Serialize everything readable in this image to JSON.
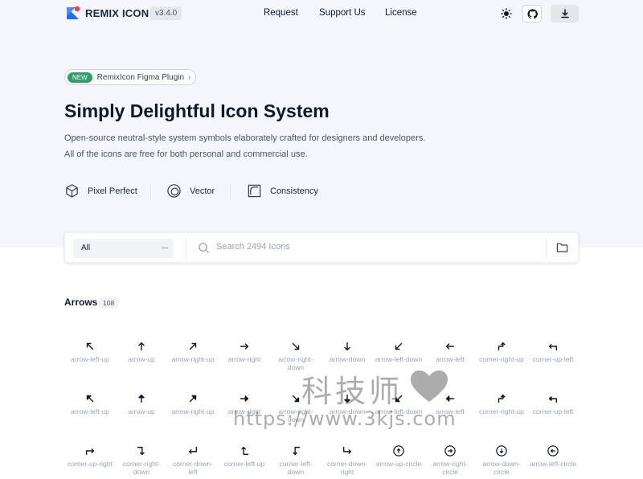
{
  "header": {
    "brand": "REMIX ICON",
    "version": "v3.4.0",
    "nav": [
      "Request",
      "Support Us",
      "License"
    ],
    "icons": [
      "sun-icon",
      "github-icon",
      "download-icon"
    ]
  },
  "hero": {
    "badge": "NEW",
    "pill_text": "RemixIcon Figma Plugin",
    "pill_chevron": "›",
    "title": "Simply Delightful Icon System",
    "desc_line1": "Open-source neutral-style system symbols elaborately crafted for designers and developers.",
    "desc_line2": "All of the icons are free for both personal and commercial use.",
    "features": [
      {
        "label": "Pixel Perfect",
        "icon": "cube-icon"
      },
      {
        "label": "Vector",
        "icon": "vector-circle-icon"
      },
      {
        "label": "Consistency",
        "icon": "consistency-square-icon"
      }
    ]
  },
  "search": {
    "category_value": "All",
    "placeholder": "Search 2494 Icons",
    "icons": [
      "search-icon",
      "folder-icon"
    ]
  },
  "category": {
    "title": "Arrows",
    "count": "108"
  },
  "icon_rows": [
    [
      {
        "label": "arrow-left-up",
        "glyph": "arrow-left-up"
      },
      {
        "label": "arrow-up",
        "glyph": "arrow-up"
      },
      {
        "label": "arrow-right-up",
        "glyph": "arrow-right-up"
      },
      {
        "label": "arrow-right",
        "glyph": "arrow-right"
      },
      {
        "label": "arrow-right-down",
        "glyph": "arrow-right-down"
      },
      {
        "label": "arrow-down",
        "glyph": "arrow-down"
      },
      {
        "label": "arrow-left-down",
        "glyph": "arrow-left-down"
      },
      {
        "label": "arrow-left",
        "glyph": "arrow-left"
      },
      {
        "label": "corner-right-up",
        "glyph": "corner-right-up"
      },
      {
        "label": "corner-up-left",
        "glyph": "corner-up-left"
      }
    ],
    [
      {
        "label": "arrow-left-up",
        "glyph": "arrow-left-up-fill"
      },
      {
        "label": "arrow-up",
        "glyph": "arrow-up-fill"
      },
      {
        "label": "arrow-right-up",
        "glyph": "arrow-right-up-fill"
      },
      {
        "label": "arrow-right",
        "glyph": "arrow-right-fill"
      },
      {
        "label": "arrow-right-down",
        "glyph": "arrow-right-down-fill"
      },
      {
        "label": "arrow-down",
        "glyph": "arrow-down-fill"
      },
      {
        "label": "arrow-left-down",
        "glyph": "arrow-left-down-fill"
      },
      {
        "label": "arrow-left",
        "glyph": "arrow-left-fill"
      },
      {
        "label": "corner-right-up",
        "glyph": "corner-right-up-fill"
      },
      {
        "label": "corner-up-left",
        "glyph": "corner-up-left-fill"
      }
    ],
    [
      {
        "label": "corner-up-right",
        "glyph": "corner-up-right"
      },
      {
        "label": "corner-right-down",
        "glyph": "corner-right-down"
      },
      {
        "label": "corner-down-left",
        "glyph": "corner-down-left"
      },
      {
        "label": "corner-left-up",
        "glyph": "corner-left-up"
      },
      {
        "label": "corner-left-down",
        "glyph": "corner-left-down"
      },
      {
        "label": "corner-down-right",
        "glyph": "corner-down-right"
      },
      {
        "label": "arrow-up-circle",
        "glyph": "arrow-up-circle"
      },
      {
        "label": "arrow-right-circle",
        "glyph": "arrow-right-circle"
      },
      {
        "label": "arrow-down-circle",
        "glyph": "arrow-down-circle"
      },
      {
        "label": "arrow-left-circle",
        "glyph": "arrow-left-circle"
      }
    ]
  ],
  "watermark": {
    "line1": "科技师",
    "line2": "https://www.3kjs.com"
  },
  "colors": {
    "accent_green": "#2f9e6b",
    "hero_bg": "#f4f6fb",
    "logo_blue": "#1e6fff",
    "logo_red": "#f23b3b"
  }
}
